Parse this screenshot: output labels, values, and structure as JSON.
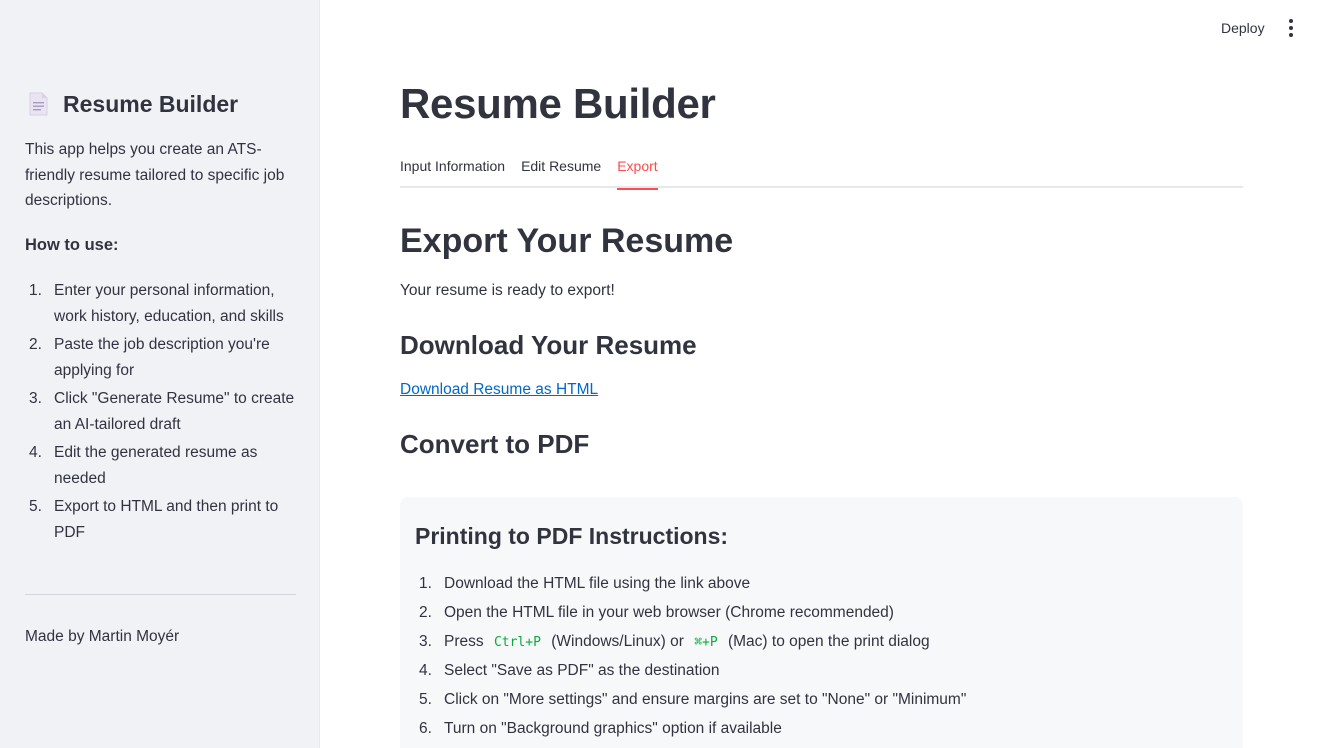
{
  "header": {
    "deploy_label": "Deploy",
    "menu_icon": "kebab-menu-icon"
  },
  "sidebar": {
    "title_icon": "document-icon",
    "title": "Resume Builder",
    "description": "This app helps you create an ATS-friendly resume tailored to specific job descriptions.",
    "how_to_heading": "How to use:",
    "steps": [
      {
        "num": "1.",
        "text": "Enter your personal information, work history, education, and skills"
      },
      {
        "num": "2.",
        "text": "Paste the job description you're applying for"
      },
      {
        "num": "3.",
        "text": "Click \"Generate Resume\" to create an AI-tailored draft"
      },
      {
        "num": "4.",
        "text": "Edit the generated resume as needed"
      },
      {
        "num": "5.",
        "text": "Export to HTML and then print to PDF"
      }
    ],
    "footer": "Made by Martin Moyér"
  },
  "main": {
    "title": "Resume Builder",
    "tabs": [
      {
        "label": "Input Information",
        "active": false
      },
      {
        "label": "Edit Resume",
        "active": false
      },
      {
        "label": "Export",
        "active": true
      }
    ],
    "export_heading": "Export Your Resume",
    "ready_text": "Your resume is ready to export!",
    "download_heading": "Download Your Resume",
    "download_link": "Download Resume as HTML",
    "convert_heading": "Convert to PDF",
    "instructions": {
      "title": "Printing to PDF Instructions:",
      "steps": [
        {
          "num": "1.",
          "text": "Download the HTML file using the link above"
        },
        {
          "num": "2.",
          "text": "Open the HTML file in your web browser (Chrome recommended)"
        },
        {
          "num": "3.",
          "pre": "Press",
          "code1": "Ctrl+P",
          "mid": "(Windows/Linux) or",
          "code2": "⌘+P",
          "post": "(Mac) to open the print dialog"
        },
        {
          "num": "4.",
          "text": "Select \"Save as PDF\" as the destination"
        },
        {
          "num": "5.",
          "text": "Click on \"More settings\" and ensure margins are set to \"None\" or \"Minimum\""
        },
        {
          "num": "6.",
          "text": "Turn on \"Background graphics\" option if available"
        }
      ]
    }
  },
  "colors": {
    "accent": "#ff4b4b",
    "link": "#0068c9",
    "code": "#09ab3b",
    "sidebar_bg": "#f0f2f6",
    "text": "#31333f"
  }
}
